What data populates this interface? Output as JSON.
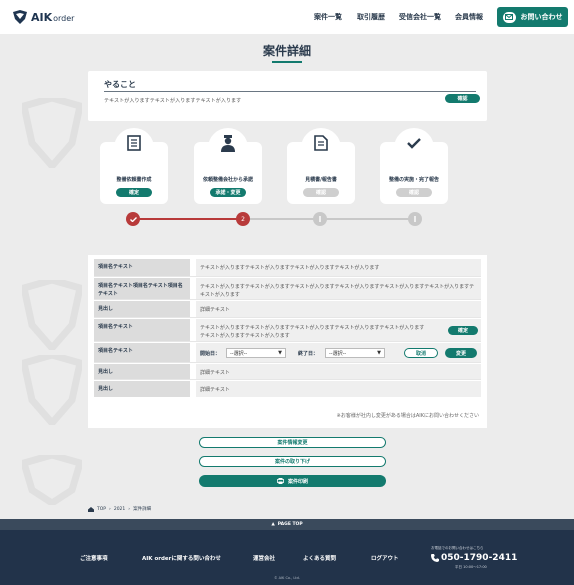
{
  "header": {
    "logo_text": "AIK",
    "logo_sub": "order",
    "nav": [
      {
        "label": "案件一覧"
      },
      {
        "label": "取引履歴"
      },
      {
        "label": "受信会社一覧"
      },
      {
        "label": "会員情報"
      }
    ],
    "contact_label": "お問い合わせ"
  },
  "page_title": "案件詳細",
  "todo": {
    "title": "やること",
    "text": "テキストが入りますテキストが入りますテキストが入ります",
    "button": "確認"
  },
  "steps": [
    {
      "label": "整備依頼書作成",
      "button": "確定",
      "state": "done",
      "icon": "document-icon"
    },
    {
      "label": "依頼整備会社から承諾",
      "button": "承諾・変更",
      "state": "current",
      "icon": "mechanic-icon"
    },
    {
      "label": "見積書/報告書",
      "button": "確認",
      "state": "pending",
      "icon": "report-icon"
    },
    {
      "label": "整備の実施・完了報告",
      "button": "確認",
      "state": "pending",
      "icon": "check-icon"
    }
  ],
  "progress": {
    "current_node": "2"
  },
  "details": {
    "rows": [
      {
        "label": "項目名テキスト",
        "value": "テキストが入りますテキストが入りますテキストが入りますテキストが入ります"
      },
      {
        "label": "項目名テキスト項目名テキスト項目名テキスト",
        "value": "テキストが入りますテキストが入りますテキストが入りますテキストが入りますテキストが入りますテキストが入りますテキストが入ります"
      },
      {
        "label": "見出し",
        "value": "詳細テキスト"
      },
      {
        "label": "項目名テキスト",
        "value": "テキストが入りますテキストが入りますテキストが入りますテキストが入りますテキストが入りますテキストが入りますテキストが入ります",
        "button": "確定"
      },
      {
        "label": "項目名テキスト"
      },
      {
        "label": "見出し",
        "value": "詳細テキスト"
      },
      {
        "label": "見出し",
        "value": "詳細テキスト"
      }
    ],
    "date_row": {
      "start_label": "開始日：",
      "start_placeholder": "--選択--",
      "end_label": "終了日：",
      "end_placeholder": "--選択--",
      "cancel_label": "取消",
      "change_label": "変更"
    },
    "note": "※お客様が社内し変更がある場合はAIKにお問い合わせください"
  },
  "actions": {
    "change_label": "案件情報変更",
    "withdraw_label": "案件の取り下げ",
    "print_label": "案件印刷"
  },
  "breadcrumb": {
    "home": "TOP",
    "items": [
      "2021",
      "案件詳細"
    ]
  },
  "footer": {
    "page_top": "PAGE TOP",
    "links": [
      {
        "label": "ご注意事項"
      },
      {
        "label": "AIK orderに関する問い合わせ"
      },
      {
        "label": "運営会社"
      },
      {
        "label": "よくある質問"
      },
      {
        "label": "ログアウト"
      }
    ],
    "tel_label": "お電話でのお問い合わせはこちら",
    "tel": "050-1790-2411",
    "tel_hours": "平日 10:00〜17:00",
    "copyright": "© AIK Co., Ltd."
  },
  "colors": {
    "accent": "#137a6e",
    "danger": "#b83a3a",
    "navy": "#22334a"
  }
}
